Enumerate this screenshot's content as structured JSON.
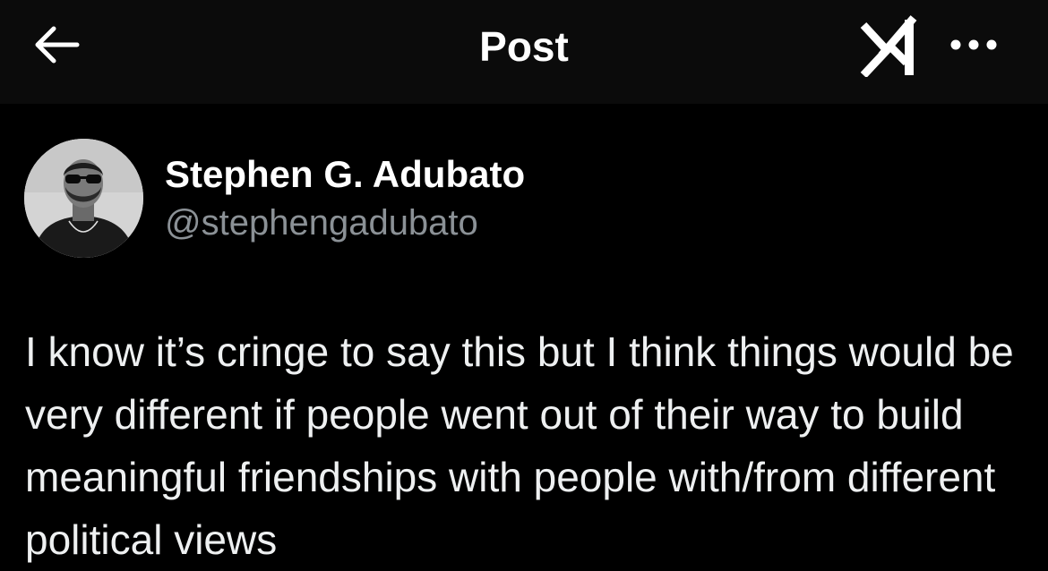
{
  "header": {
    "title": "Post",
    "back_icon": "arrow-left-icon",
    "grok_icon": "grok-icon",
    "more_icon": "more-horizontal-icon"
  },
  "author": {
    "name": "Stephen G. Adubato",
    "handle": "@stephengadubato"
  },
  "post": {
    "text": "I know it’s cringe to say this but I think things would be very different if people went out of their way to build meaningful friendships with people with/from different political views"
  },
  "colors": {
    "background": "#000000",
    "header_background": "#0b0b0b",
    "text_primary": "#ffffff",
    "text_secondary": "#8b9196"
  }
}
